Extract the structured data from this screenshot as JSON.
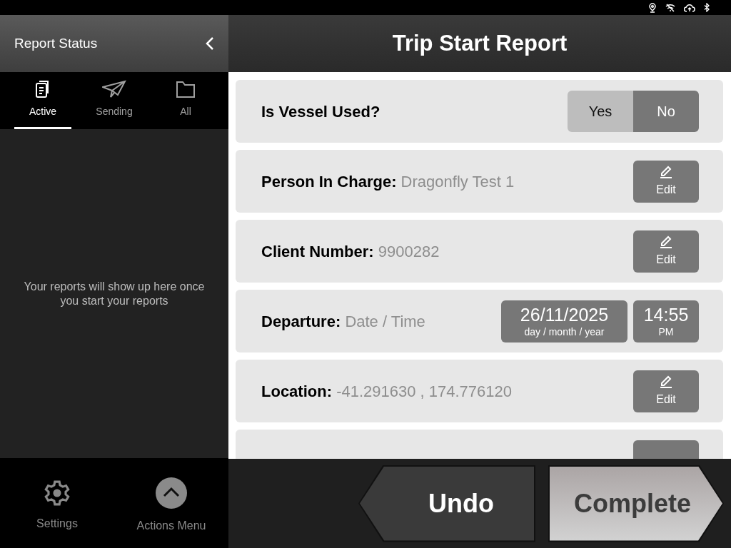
{
  "sidebar": {
    "title": "Report Status",
    "tabs": [
      {
        "label": "Active",
        "kind": "document",
        "selected": true
      },
      {
        "label": "Sending",
        "kind": "plane",
        "selected": false
      },
      {
        "label": "All",
        "kind": "folder",
        "selected": false
      }
    ],
    "empty_message": "Your reports will show up here once you start your reports",
    "footer": [
      {
        "label": "Settings",
        "kind": "gear"
      },
      {
        "label": "Actions Menu",
        "kind": "chevron-up"
      }
    ]
  },
  "main": {
    "title": "Trip Start Report",
    "rows": [
      {
        "kind": "toggle",
        "label": "Is Vessel Used?",
        "options": [
          {
            "label": "Yes",
            "selected": false
          },
          {
            "label": "No",
            "selected": true
          }
        ]
      },
      {
        "kind": "edit",
        "label": "Person In Charge:",
        "value": "Dragonfly Test 1",
        "button": "Edit"
      },
      {
        "kind": "edit",
        "label": "Client Number:",
        "value": "9900282",
        "button": "Edit"
      },
      {
        "kind": "datetime",
        "label": "Departure:",
        "value": "Date / Time",
        "date": "26/11/2025",
        "date_hint": "day / month / year",
        "time": "14:55",
        "time_hint": "PM"
      },
      {
        "kind": "edit",
        "label": "Location:",
        "value": "-41.291630 , 174.776120",
        "button": "Edit"
      },
      {
        "kind": "edit"
      }
    ],
    "actions": [
      {
        "label": "Undo",
        "kind": "back"
      },
      {
        "label": "Complete",
        "kind": "forward"
      }
    ]
  }
}
